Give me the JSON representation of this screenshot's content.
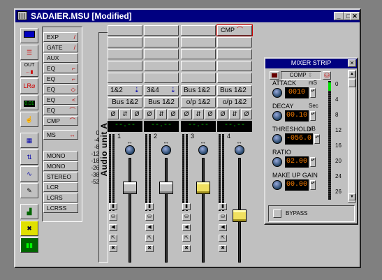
{
  "window": {
    "title": "SADAIER.MSU [Modified]"
  },
  "toolbar": {
    "tools": [
      "io-icon",
      "filter-bank-icon",
      "out-route-icon",
      "lr-phase-icon",
      "level-display-icon",
      "touch-icon",
      "grid-icon",
      "patch-icon",
      "scope-icon",
      "pen-icon",
      "spectrum-icon",
      "cross-icon",
      "meters-icon"
    ],
    "level_value": "0.01",
    "out_label": "OUT"
  },
  "modules": [
    "EXP",
    "GATE",
    "AUX",
    "EQ",
    "EQ",
    "EQ",
    "EQ",
    "EQ",
    "CMP",
    "MS",
    "MONO",
    "MONO",
    "STEREO",
    "LCR",
    "LCRS",
    "LCRSS"
  ],
  "scale": [
    "0",
    "-4",
    "-8",
    "-12",
    "-18",
    "-26",
    "-38",
    "-52"
  ],
  "vertical_label": "Audio unit A",
  "channels": [
    {
      "number": "1",
      "input": "1&2",
      "bus": "Bus 1&2",
      "display": "--.--",
      "first_slot": "",
      "fader_level": 0.72,
      "fader_color": "grey"
    },
    {
      "number": "2",
      "input": "3&4",
      "bus": "Bus 1&2",
      "display": "--.--",
      "first_slot": "",
      "fader_level": 0.72,
      "fader_color": "grey"
    },
    {
      "number": "3",
      "input": "Bus 1&2",
      "bus": "o/p 1&2",
      "display": "--.--",
      "first_slot": "",
      "fader_level": 0.72,
      "fader_color": "yellow"
    },
    {
      "number": "4",
      "input": "Bus 1&2",
      "bus": "o/p 1&2",
      "display": "--.--",
      "first_slot": "CMP",
      "fader_level": 0.38,
      "fader_color": "yellow"
    }
  ],
  "mixer_strip": {
    "title": "MIXER STRIP",
    "module": "COMP",
    "params": [
      {
        "label": "ATTACK",
        "unit": "mS",
        "value": "0010"
      },
      {
        "label": "DECAY",
        "unit": "Sec",
        "value": "00.10"
      },
      {
        "label": "THRESHOLD",
        "unit": "dB",
        "value": "-056.0"
      },
      {
        "label": "RATIO",
        "unit": "",
        "value": "02.00"
      },
      {
        "label": "MAKE UP GAIN",
        "unit": "",
        "value": "00.00"
      }
    ],
    "meter_scale": [
      "0",
      "4",
      "8",
      "12",
      "16",
      "20",
      "24",
      "26"
    ],
    "bypass_label": "BYPASS"
  },
  "colors": {
    "titlebar": "#000080",
    "face": "#c0c0c0",
    "display_green": "#00c000",
    "display_orange": "#ff8000",
    "fader_yellow": "#f0e060"
  }
}
